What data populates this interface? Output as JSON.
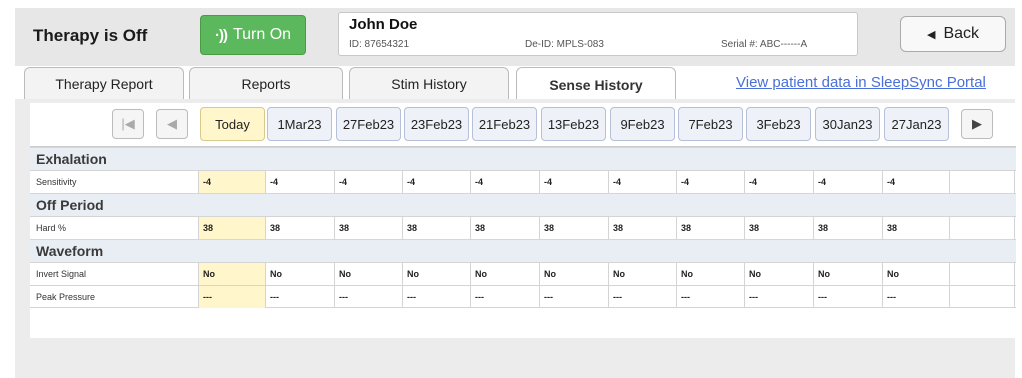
{
  "header": {
    "therapy_status": "Therapy is Off",
    "turn_on_label": "Turn On",
    "back_label": "Back"
  },
  "patient": {
    "name": "John Doe",
    "id": "ID: 87654321",
    "deid": "De-ID: MPLS-083",
    "serial": "Serial #: ABC------A"
  },
  "tabs": [
    {
      "label": "Therapy Report"
    },
    {
      "label": "Reports"
    },
    {
      "label": "Stim History"
    },
    {
      "label": "Sense History",
      "active": true
    }
  ],
  "portal_link": "View patient data in SleepSync Portal",
  "dates": [
    "Today",
    "1Mar23",
    "27Feb23",
    "23Feb23",
    "21Feb23",
    "13Feb23",
    "9Feb23",
    "7Feb23",
    "3Feb23",
    "30Jan23",
    "27Jan23"
  ],
  "sections": [
    {
      "title": "Exhalation",
      "rows": [
        {
          "label": "Sensitivity",
          "values": [
            "-4",
            "-4",
            "-4",
            "-4",
            "-4",
            "-4",
            "-4",
            "-4",
            "-4",
            "-4",
            "-4"
          ]
        }
      ]
    },
    {
      "title": "Off Period",
      "rows": [
        {
          "label": "Hard %",
          "values": [
            "38",
            "38",
            "38",
            "38",
            "38",
            "38",
            "38",
            "38",
            "38",
            "38",
            "38"
          ]
        }
      ]
    },
    {
      "title": "Waveform",
      "rows": [
        {
          "label": "Invert Signal",
          "values": [
            "No",
            "No",
            "No",
            "No",
            "No",
            "No",
            "No",
            "No",
            "No",
            "No",
            "No"
          ]
        },
        {
          "label": "Peak Pressure",
          "values": [
            "---",
            "---",
            "---",
            "---",
            "---",
            "---",
            "---",
            "---",
            "---",
            "---",
            "---"
          ]
        }
      ]
    }
  ],
  "colors": {
    "turn_on": "#5cb85c",
    "today_highlight": "#fff6cc",
    "link": "#4a6fd8",
    "section_bg": "#e9edf4"
  },
  "icons": {
    "turn_on": "signal-waves-icon",
    "back": "left-triangle-icon",
    "first": "skip-first-icon",
    "prev": "prev-arrow-icon",
    "next": "next-arrow-icon"
  }
}
